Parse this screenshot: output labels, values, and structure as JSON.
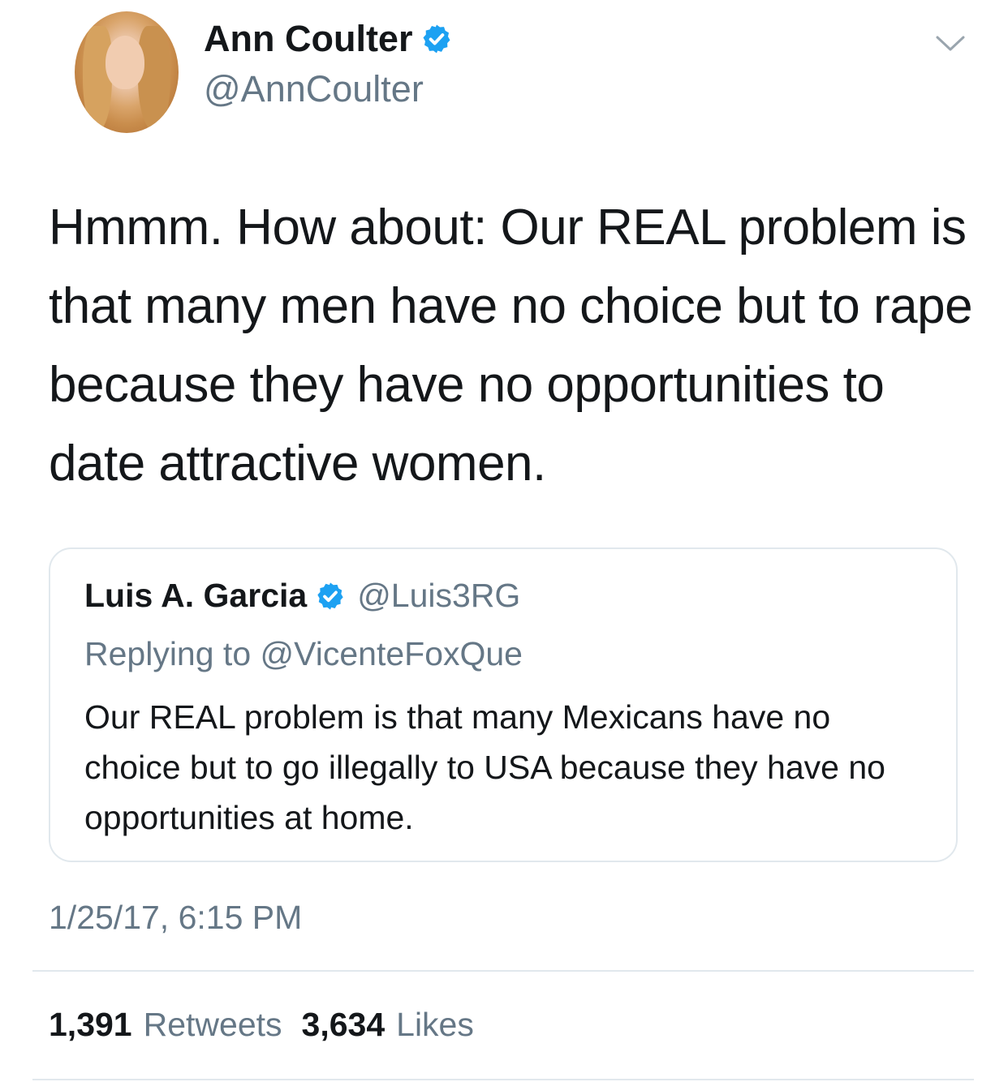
{
  "tweet": {
    "author": {
      "name": "Ann Coulter",
      "handle": "@AnnCoulter",
      "verified": true
    },
    "text": "Hmmm.  How about: Our REAL problem is that many men have no choice but to rape because they have no opportunities to date attractive women.",
    "quoted_tweet": {
      "author_name": "Luis A. Garcia",
      "author_handle": "@Luis3RG",
      "verified": true,
      "replying_to": "Replying to @VicenteFoxQue",
      "text": "Our REAL problem is that many Mexicans have no choice but to go illegally to USA because they have no opportunities at home."
    },
    "timestamp": "1/25/17, 6:15 PM",
    "stats": {
      "retweets_count": "1,391",
      "retweets_label": "Retweets",
      "likes_count": "3,634",
      "likes_label": "Likes"
    }
  },
  "icons": {
    "verified": "verified-badge-icon",
    "menu": "chevron-down-icon"
  },
  "colors": {
    "primary_text": "#14171a",
    "secondary_text": "#657786",
    "verified_blue": "#1da1f2",
    "border": "#e1e8ed"
  }
}
